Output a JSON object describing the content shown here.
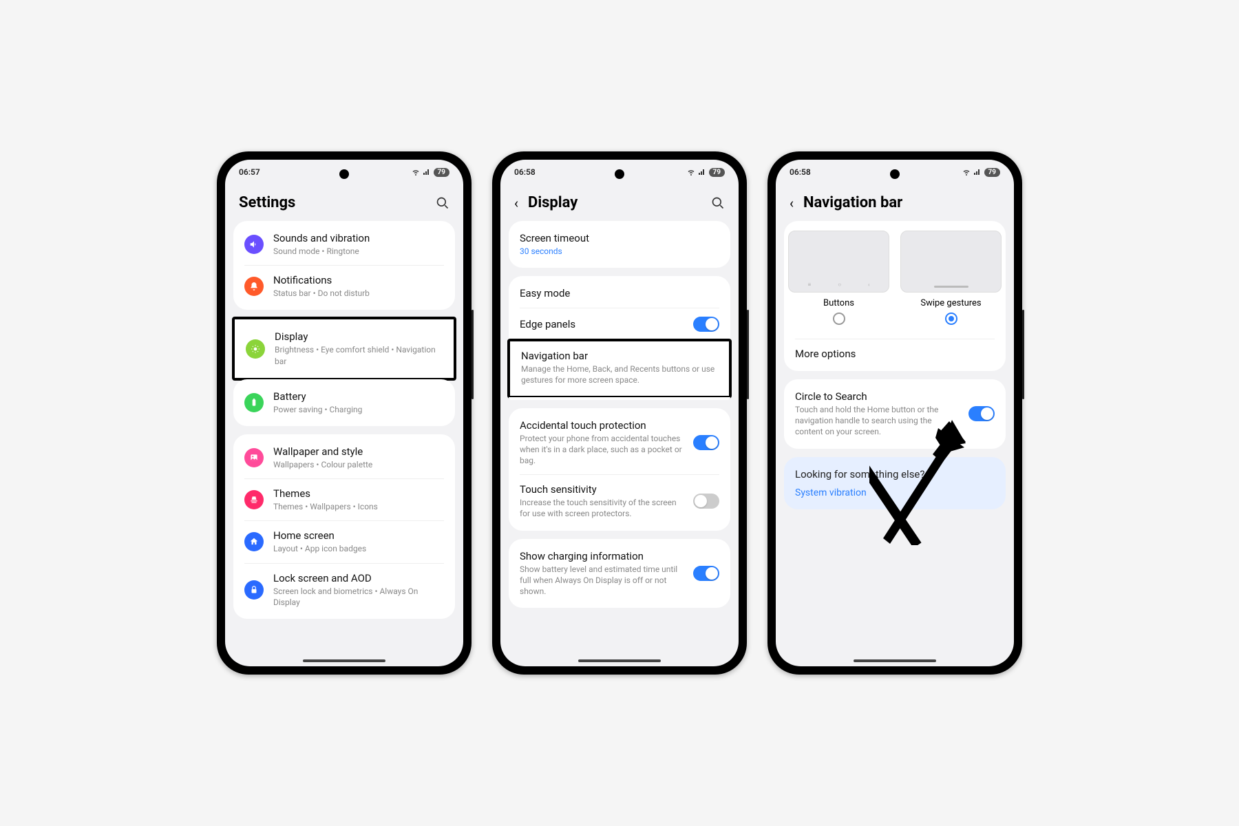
{
  "status": {
    "time1": "06:57",
    "time2": "06:58",
    "time3": "06:58",
    "battery": "79"
  },
  "p1": {
    "title": "Settings",
    "items": [
      {
        "title": "Sounds and vibration",
        "sub": "Sound mode  •  Ringtone",
        "color": "#6a4fff",
        "icon": "volume"
      },
      {
        "title": "Notifications",
        "sub": "Status bar  •  Do not disturb",
        "color": "#ff5a2a",
        "icon": "bell"
      },
      {
        "title": "Display",
        "sub": "Brightness  •  Eye comfort shield  •  Navigation bar",
        "color": "#8bd43a",
        "icon": "sun"
      },
      {
        "title": "Battery",
        "sub": "Power saving  •  Charging",
        "color": "#3ad45a",
        "icon": "battery"
      },
      {
        "title": "Wallpaper and style",
        "sub": "Wallpapers  •  Colour palette",
        "color": "#ff4b9a",
        "icon": "image"
      },
      {
        "title": "Themes",
        "sub": "Themes  •  Wallpapers  •  Icons",
        "color": "#ff2a6a",
        "icon": "brush"
      },
      {
        "title": "Home screen",
        "sub": "Layout  •  App icon badges",
        "color": "#2a6aff",
        "icon": "home"
      },
      {
        "title": "Lock screen and AOD",
        "sub": "Screen lock and biometrics  •  Always On Display",
        "color": "#2a6aff",
        "icon": "lock"
      }
    ]
  },
  "p2": {
    "title": "Display",
    "timeout": {
      "title": "Screen timeout",
      "value": "30 seconds"
    },
    "rows": [
      {
        "title": "Easy mode",
        "sub": "",
        "toggle": null
      },
      {
        "title": "Edge panels",
        "sub": "",
        "toggle": true
      },
      {
        "title": "Navigation bar",
        "sub": "Manage the Home, Back, and Recents buttons or use gestures for more screen space.",
        "toggle": null
      },
      {
        "title": "Accidental touch protection",
        "sub": "Protect your phone from accidental touches when it's in a dark place, such as a pocket or bag.",
        "toggle": true
      },
      {
        "title": "Touch sensitivity",
        "sub": "Increase the touch sensitivity of the screen for use with screen protectors.",
        "toggle": false
      },
      {
        "title": "Show charging information",
        "sub": "Show battery level and estimated time until full when Always On Display is off or not shown.",
        "toggle": true
      }
    ]
  },
  "p3": {
    "title": "Navigation bar",
    "opt1": "Buttons",
    "opt2": "Swipe gestures",
    "more": "More options",
    "cts": {
      "title": "Circle to Search",
      "sub": "Touch and hold the Home button or the navigation handle to search using the content on your screen."
    },
    "else": {
      "title": "Looking for something else?",
      "link": "System vibration"
    }
  }
}
